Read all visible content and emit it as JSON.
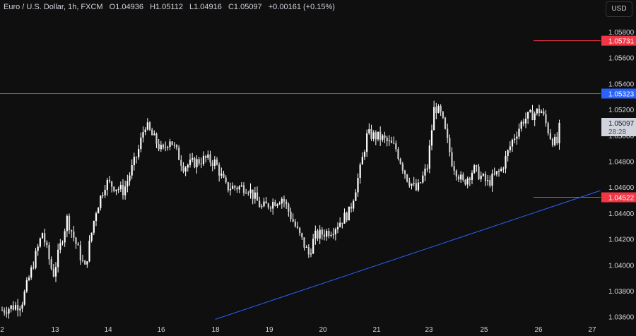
{
  "header": {
    "symbol": "Euro / U.S. Dollar, 1h, FXCM",
    "open": "O1.04936",
    "high": "H1.05112",
    "low": "L1.04916",
    "close": "C1.05097",
    "change": "+0.00161 (+0.15%)"
  },
  "currency_button": "USD",
  "chart_data": {
    "type": "candlestick",
    "title": "Euro / U.S. Dollar, 1h, FXCM",
    "ylim": [
      1.0355,
      1.0592
    ],
    "y_ticks": [
      "1.05800",
      "1.05600",
      "1.05400",
      "1.05200",
      "1.05000",
      "1.04800",
      "1.04600",
      "1.04400",
      "1.04200",
      "1.04000",
      "1.03800",
      "1.03600"
    ],
    "x_ticks": [
      "2",
      "13",
      "14",
      "16",
      "18",
      "19",
      "20",
      "21",
      "23",
      "25",
      "26",
      "27"
    ],
    "close_path_days_price": [
      [
        0,
        1.0365
      ],
      [
        0.36,
        1.037
      ],
      [
        0.75,
        1.0425
      ],
      [
        0.95,
        1.0392
      ],
      [
        1.21,
        1.0436
      ],
      [
        1.54,
        1.0397
      ],
      [
        1.74,
        1.0441
      ],
      [
        1.93,
        1.0464
      ],
      [
        2.26,
        1.0457
      ],
      [
        2.53,
        1.0487
      ],
      [
        2.66,
        1.0509
      ],
      [
        2.79,
        1.05
      ],
      [
        2.99,
        1.0487
      ],
      [
        3.12,
        1.0498
      ],
      [
        3.38,
        1.0476
      ],
      [
        3.78,
        1.0482
      ],
      [
        3.97,
        1.0479
      ],
      [
        4.17,
        1.046
      ],
      [
        4.57,
        1.046
      ],
      [
        4.83,
        1.0444
      ],
      [
        5.22,
        1.0452
      ],
      [
        5.49,
        1.0427
      ],
      [
        5.71,
        1.0408
      ],
      [
        5.82,
        1.0422
      ],
      [
        6.14,
        1.0427
      ],
      [
        6.47,
        1.0441
      ],
      [
        6.67,
        1.0474
      ],
      [
        6.8,
        1.0501
      ],
      [
        7.07,
        1.0498
      ],
      [
        7.33,
        1.049
      ],
      [
        7.53,
        1.0468
      ],
      [
        7.72,
        1.0457
      ],
      [
        7.92,
        1.0476
      ],
      [
        8.05,
        1.0523
      ],
      [
        8.18,
        1.0515
      ],
      [
        8.38,
        1.0479
      ],
      [
        8.58,
        1.0463
      ],
      [
        8.78,
        1.0474
      ],
      [
        9.04,
        1.0463
      ],
      [
        9.3,
        1.0474
      ],
      [
        9.5,
        1.0496
      ],
      [
        9.7,
        1.0512
      ],
      [
        10.03,
        1.052
      ],
      [
        10.22,
        1.0498
      ],
      [
        10.33,
        1.0493
      ],
      [
        10.38,
        1.05097
      ]
    ],
    "levels": [
      {
        "label": "1.05731",
        "price": 1.05731,
        "color": "#f23645"
      },
      {
        "label": "1.05323",
        "price": 1.05323,
        "color": "#2962ff"
      },
      {
        "label": "1.04522",
        "price": 1.04522,
        "color": "#f23645"
      }
    ],
    "trendline": {
      "start": [
        3.97,
        1.0358
      ],
      "end": [
        11.14,
        1.04574
      ],
      "color": "#2962ff"
    },
    "last_price": {
      "label": "1.05097",
      "countdown": "28:28"
    },
    "colors": {
      "candle": "#ffffff",
      "grid": "#0f0f0f",
      "background": "#0f0f0f"
    }
  }
}
